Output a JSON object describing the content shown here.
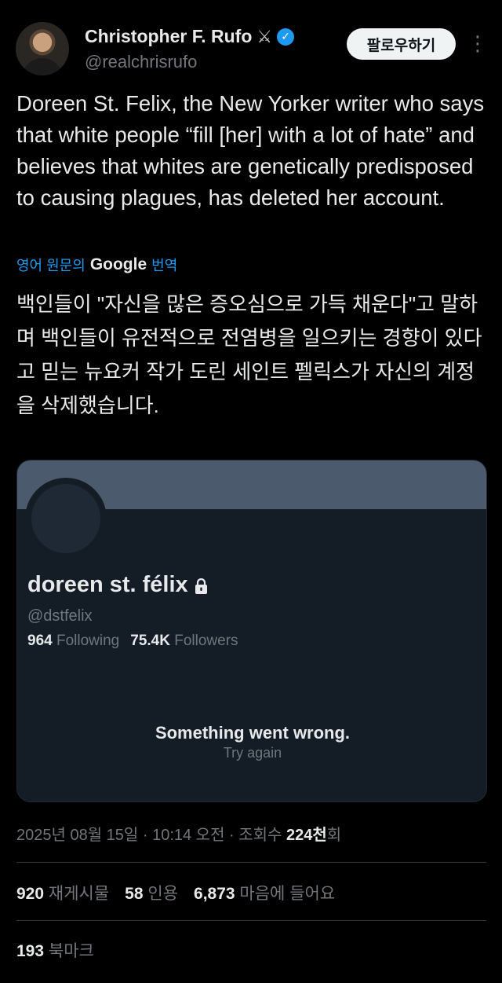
{
  "author": {
    "name": "Christopher F. Rufo",
    "badge_emoji": "⚔",
    "handle": "@realchrisrufo",
    "follow_label": "팔로우하기"
  },
  "tweet": {
    "text": "Doreen St. Felix, the New Yorker writer who says that white people “fill [her] with a lot of hate” and believes that whites are genetically predisposed to causing plagues, has deleted her account.",
    "translate_prefix": "영어 원문의",
    "translate_brand": "Google",
    "translate_suffix": "번역",
    "translated_text": "백인들이 \"자신을 많은 증오심으로 가득 채운다\"고 말하며 백인들이 유전적으로 전염병을 일으키는 경향이 있다고 믿는 뉴요커 작가 도린 세인트 펠릭스가 자신의 계정을 삭제했습니다."
  },
  "card": {
    "name": "doreen st. félix",
    "handle": "@dstfelix",
    "following_count": "964",
    "following_label": "Following",
    "followers_count": "75.4K",
    "followers_label": "Followers",
    "error_title": "Something went wrong.",
    "error_retry": "Try again"
  },
  "meta": {
    "timestamp": "2025년 08월 15일 · 10:14 오전 · 조회수",
    "views": "224천",
    "views_suffix": "회"
  },
  "engagement": {
    "retweets_count": "920",
    "retweets_label": "재게시물",
    "quotes_count": "58",
    "quotes_label": "인용",
    "likes_count": "6,873",
    "likes_label": "마음에 들어요",
    "bookmarks_count": "193",
    "bookmarks_label": "북마크"
  },
  "colors": {
    "background": "#000000",
    "accent": "#1d9bf0",
    "card_bg": "#141c26",
    "banner": "#4b5b6d"
  }
}
